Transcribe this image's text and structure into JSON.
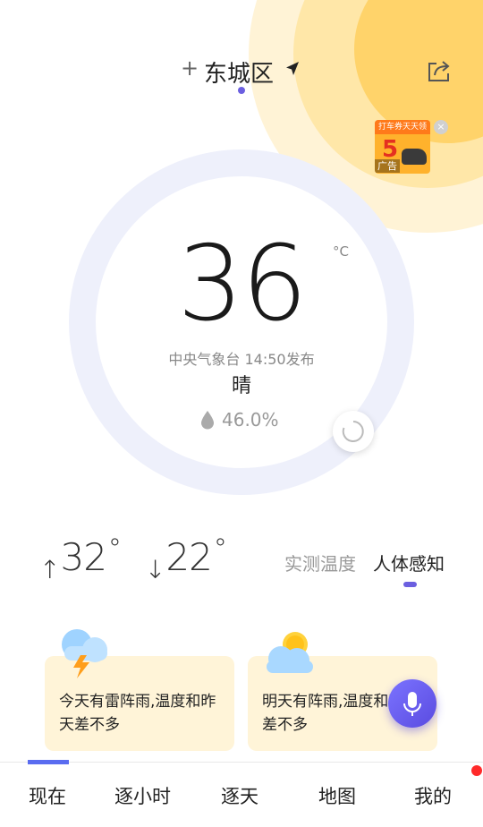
{
  "header": {
    "add_symbol": "+",
    "city": "东城区"
  },
  "ad": {
    "banner": "打车券天天领",
    "number": "5",
    "label": "广告",
    "close": "×"
  },
  "current": {
    "temperature": "36",
    "unit": "°C",
    "publish": "中央气象台 14:50发布",
    "condition": "晴",
    "humidity": "46.0%"
  },
  "range": {
    "high_arrow": "↑",
    "high": "32",
    "low_arrow": "↓",
    "low": "22",
    "degree": "°"
  },
  "temp_tabs": {
    "measured": "实测温度",
    "feel": "人体感知",
    "active": "feel"
  },
  "forecast_cards": {
    "today": {
      "text": "今天有雷阵雨,温度和昨天差不多",
      "icon": "thunderstorm-icon"
    },
    "tomorrow": {
      "text": "明天有阵雨,温度和昨天差不多",
      "icon": "partly-cloudy-icon"
    }
  },
  "nav": {
    "now": "现在",
    "hourly": "逐小时",
    "daily": "逐天",
    "map": "地图",
    "mine": "我的",
    "active": "now"
  },
  "colors": {
    "accent": "#6b5fe0",
    "ring": "#eef0fb",
    "card_bg": "#fff4d8",
    "sun": "#ffd36a",
    "badge": "#ff2a2a"
  }
}
